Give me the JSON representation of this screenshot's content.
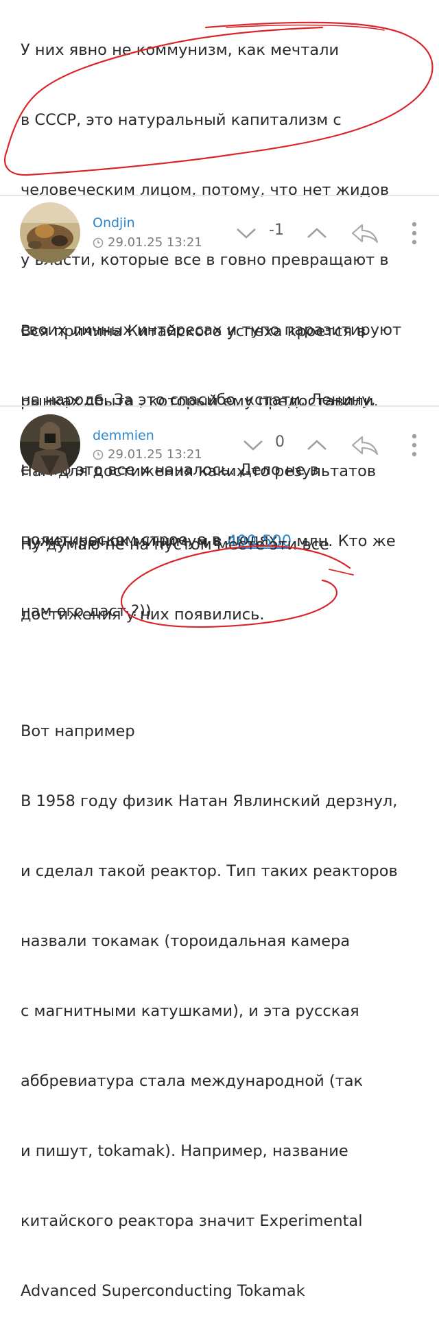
{
  "top_post": {
    "lines": [
      "У них явно не коммунизм, как мечтали",
      "в СССР, это натуральный капитализм с",
      "человеческим лицом, потому, что нет жидов",
      "у власти, которые все в говно превращают в",
      "своих личных интересах и тупо паразитируют",
      "на народе. За это спасибо, кстати, Ленину,",
      "с него это все и началось. Дело не в",
      "политическом строе, а в людях."
    ]
  },
  "comments": [
    {
      "username": "Ondjin",
      "date": "29.01.25 13:21",
      "score": "-1",
      "icons": {
        "down": "chevron-down-icon",
        "up": "chevron-up-icon",
        "reply": "reply-arrow-icon",
        "more": "more-vertical-icon",
        "date": "clock-icon"
      },
      "body_lines": [
        "Вся причина Китайского успеха кроется в",
        "рынках сбыта , который ему предоставили.",
        "Нам для достижения каких-то результатов"
      ],
      "body_line4_before": "нужен рынок минимум в ",
      "body_link": "400-500",
      "body_line4_after": " млн. Кто же",
      "body_line5": "нам его даст ?))"
    },
    {
      "username": "demmien",
      "date": "29.01.25 13:21",
      "score": "0",
      "body_lines": [
        "Ну думаю не на пустом месте эти все",
        "достижения у них появились.",
        "",
        "Вот например",
        "В 1958 году физик Натан Явлинский дерзнул,",
        "и сделал такой реактор. Тип таких реакторов",
        "назвали токамак (тороидальная камера",
        "с магнитными катушками), и эта русская",
        "аббревиатура стала международной (так",
        "и пишут, tokamak). Например, название",
        "китайского реактора значит Experimental",
        "Advanced Superconducting Tokamak"
      ]
    }
  ],
  "colors": {
    "link": "#2f86c9",
    "annotation": "#d9262b",
    "divider": "#e6e6e6"
  }
}
